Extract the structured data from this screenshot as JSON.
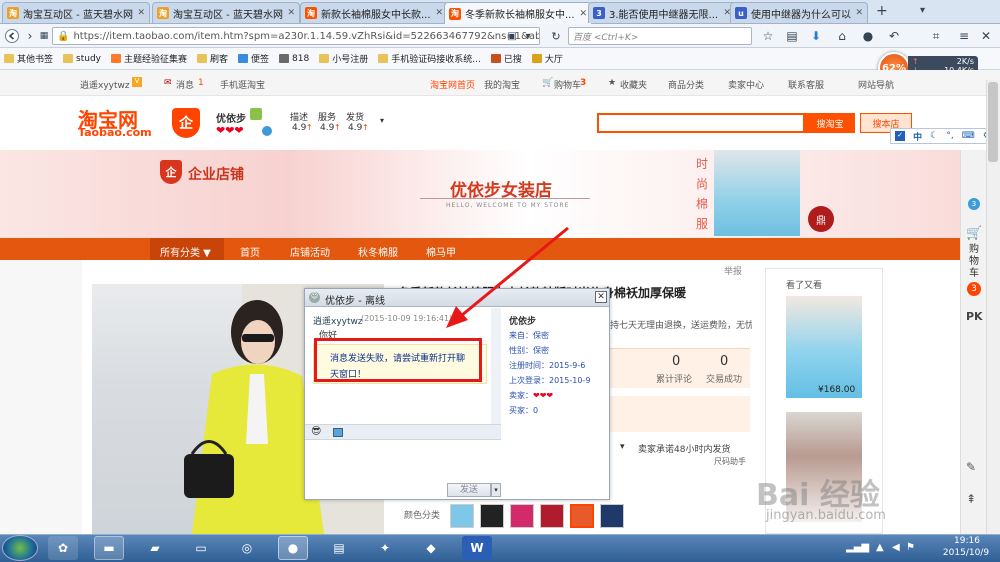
{
  "browser": {
    "tabs": [
      {
        "title": "淘宝互动区 - 蓝天碧水网",
        "fav_color": "#e8a22c",
        "fav_glyph": "淘"
      },
      {
        "title": "淘宝互动区 - 蓝天碧水网",
        "fav_color": "#e8a22c",
        "fav_glyph": "淘"
      },
      {
        "title": "新款长袖棉服女中长款...",
        "fav_color": "#ff5000",
        "fav_glyph": "淘"
      },
      {
        "title": "冬季新款长袖棉服女中...",
        "fav_color": "#ff5000",
        "fav_glyph": "淘"
      },
      {
        "title": "3.能否使用中继器无限...",
        "fav_color": "#3a5fc8",
        "fav_glyph": "3"
      },
      {
        "title": "使用中继器为什么可以...",
        "fav_color": "#3a5fc8",
        "fav_glyph": "u"
      }
    ],
    "new_tab_label": "+",
    "url": "https://item.taobao.com/item.htm?spm=a230r.1.14.59.vZhRsi&id=522663467792&ns=1&abbucket",
    "search_placeholder": "百度 <Ctrl+K>",
    "perf_percent": "62%",
    "net_up": "2K/s",
    "net_down": "10.4K/s"
  },
  "bookmarks": [
    "其他书签",
    "study",
    "主题经验征集赛",
    "刷客",
    "便签",
    "818",
    "小号注册",
    "手机验证码接收系统...",
    "已搜",
    "大厅"
  ],
  "taobao_topbar": {
    "username": "逍遥xyytwz",
    "messages_label": "消息",
    "messages_count": "1",
    "mobile": "手机逛淘宝",
    "home": "淘宝网首页",
    "my_taobao": "我的淘宝",
    "cart": "购物车",
    "cart_count": "3",
    "favorites": "收藏夹",
    "categories": "商品分类",
    "seller": "卖家中心",
    "support": "联系客服",
    "sitemap": "网站导航"
  },
  "store_header": {
    "logo_cn": "淘宝网",
    "logo_en": "Taobao.com",
    "store_name": "优依步",
    "ratings": [
      {
        "label": "描述",
        "value": "4.9"
      },
      {
        "label": "服务",
        "value": "4.9"
      },
      {
        "label": "发货",
        "value": "4.9"
      }
    ],
    "search_btn": "搜淘宝",
    "store_search_btn": "搜本店"
  },
  "banner": {
    "enterprise": "企业店铺",
    "store_title": "优依步女装店",
    "welcome": "HELLO, WELCOME TO MY STORE",
    "side_text": "时尚棉服",
    "stamp": "鼎"
  },
  "store_menu": [
    "所有分类 ▼",
    "首页",
    "店铺活动",
    "秋冬棉服",
    "棉马甲"
  ],
  "product": {
    "report": "举报",
    "title": "冬季新款长袖棉服女中长款韩版时尚修身棉袄加厚保暖",
    "return_note": "持七天无理由退换，送运费险，无忧",
    "comments_count": "0",
    "comments_label": "累计评论",
    "sales_count": "0",
    "sales_label": "交易成功",
    "shipping": "卖家承诺48小时内发货",
    "size_helper": "尺码助手",
    "color_label": "颜色分类",
    "watched_title": "看了又看",
    "related_price": "¥168.00"
  },
  "chat": {
    "title": "优依步 - 离线",
    "sender": "逍遥xyytwz",
    "timestamp": "(2015-10-09 19:16:41)",
    "message": "你好",
    "error": "消息发送失败，请尝试重新打开聊天窗口！",
    "send_btn": "发送",
    "info": {
      "name": "优依步",
      "from_label": "来自：",
      "from": "保密",
      "gender_label": "性别：",
      "gender": "保密",
      "reg_label": "注册时间：",
      "reg": "2015-9-6",
      "last_label": "上次登录：",
      "last": "2015-10-9",
      "seller_label": "卖家：",
      "buyer_label": "买家：",
      "buyer": "0"
    }
  },
  "right_sidebar": {
    "cart_label": "购物车",
    "cart_count": "3",
    "pk": "PK"
  },
  "float_toolbar": {
    "lang": "中"
  },
  "watermark": {
    "line1": "Bai 经验",
    "line2": "jingyan.baidu.com"
  },
  "taskbar": {
    "time": "19:16",
    "date": "2015/10/9"
  }
}
